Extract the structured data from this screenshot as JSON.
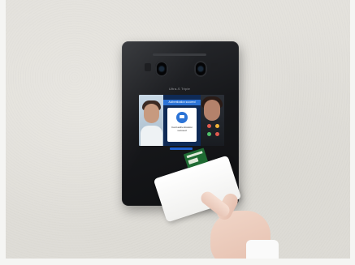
{
  "scene": {
    "description": "",
    "device": {
      "model_label": "Ultra-S Triple",
      "screen": {
        "top_banner": "Authentication succeed",
        "popup_text_line1": "Card authentication",
        "popup_text_line2": "succeed"
      }
    }
  },
  "colors": {
    "device_body": "#17181b",
    "screen_accent": "#2b73d6",
    "card_logo": "#1f6b33",
    "wall": "#e1dfda"
  },
  "icons": {
    "card_icon": "card-icon",
    "reader_icon": "nfc-reader-icon"
  }
}
